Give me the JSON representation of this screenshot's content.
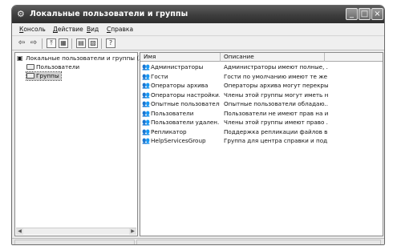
{
  "window": {
    "title": "Локальные пользователи и группы",
    "title_icon": "gear-icon",
    "controls": {
      "minimize": "_",
      "maximize": "□",
      "close": "×"
    }
  },
  "menu": [
    {
      "label": "Консоль",
      "underline": "К",
      "rest": "онсоль"
    },
    {
      "label": "Действие",
      "underline": "Д",
      "rest": "ействие"
    },
    {
      "label": "Вид",
      "underline": "В",
      "rest": "ид"
    },
    {
      "label": "Справка",
      "underline": "С",
      "rest": "правка"
    }
  ],
  "toolbar": {
    "back": "⇦",
    "forward": "⇨",
    "up": "⤒",
    "show_tree": "▦",
    "properties": "▤",
    "export": "▧",
    "help": "?"
  },
  "tree": {
    "root": "Локальные пользователи и группы (лок",
    "items": [
      {
        "label": "Пользователи",
        "selected": false
      },
      {
        "label": "Группы",
        "selected": true
      }
    ]
  },
  "list": {
    "columns": [
      "Имя",
      "Описание"
    ],
    "rows": [
      {
        "name": "Администраторы",
        "description": "Администраторы имеют полные, ..."
      },
      {
        "name": "Гости",
        "description": "Гости по умолчанию имеют те же ..."
      },
      {
        "name": "Операторы архива",
        "description": "Операторы архива могут перекры..."
      },
      {
        "name": "Операторы настройки...",
        "description": "Члены этой группы могут иметь н..."
      },
      {
        "name": "Опытные пользователи",
        "description": "Опытные пользователи обладаю..."
      },
      {
        "name": "Пользователи",
        "description": "Пользователи не имеют прав на и..."
      },
      {
        "name": "Пользователи удален...",
        "description": "Члены этой группы имеют право ..."
      },
      {
        "name": "Репликатор",
        "description": "Поддержка репликации файлов в ..."
      },
      {
        "name": "HelpServicesGroup",
        "description": "Группа для центра справки и под..."
      }
    ]
  },
  "icons": {
    "group": "group-icon",
    "folder": "folder-icon",
    "root": "computer-icon"
  },
  "colors": {
    "titlebar": "#3d3d3d",
    "window_bg": "#ececec",
    "selection": "#cfcfcf"
  }
}
